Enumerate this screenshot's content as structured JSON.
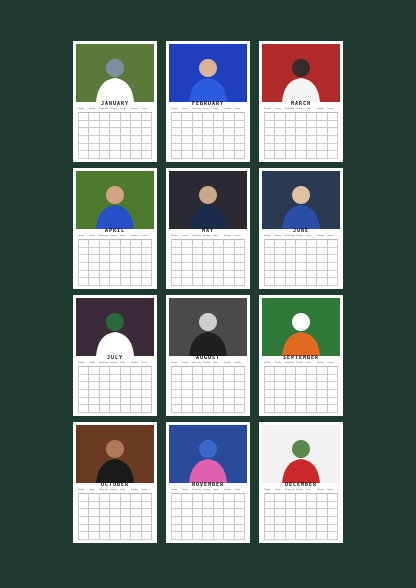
{
  "weekdays": [
    "Monday",
    "Tuesday",
    "Wednesday",
    "Thursday",
    "Friday",
    "Saturday",
    "Sunday"
  ],
  "months": [
    {
      "name": "JANUARY",
      "photo": "player-lifting-trophy-photo",
      "colors": [
        "#5a7a3a",
        "#ffffff",
        "#7b8fa0"
      ]
    },
    {
      "name": "FEBRUARY",
      "photo": "player-blue-kit-photo",
      "colors": [
        "#1f3fbf",
        "#2d5be0",
        "#d9b49a"
      ]
    },
    {
      "name": "MARCH",
      "photo": "player-white-kit-photo",
      "colors": [
        "#b02a2a",
        "#f4f4f4",
        "#3a2a2a"
      ]
    },
    {
      "name": "APRIL",
      "photo": "player-blue-shirt-portrait-photo",
      "colors": [
        "#4e7a2f",
        "#2550c8",
        "#d2a283"
      ]
    },
    {
      "name": "MAY",
      "photo": "players-dark-kit-photo",
      "colors": [
        "#2a2a32",
        "#1a2a4a",
        "#c8a888"
      ]
    },
    {
      "name": "JUNE",
      "photo": "player-number-22-photo",
      "colors": [
        "#2a3a52",
        "#2a4ea8",
        "#e0c0a0"
      ]
    },
    {
      "name": "JULY",
      "photo": "player-celebrating-photo",
      "colors": [
        "#3a2a3a",
        "#ffffff",
        "#2a6a3a"
      ]
    },
    {
      "name": "AUGUST",
      "photo": "dressing-room-shirt-photo",
      "colors": [
        "#4a4a4a",
        "#202020",
        "#cfcfcf"
      ]
    },
    {
      "name": "SEPTEMBER",
      "photo": "player-running-photo",
      "colors": [
        "#2f7a3a",
        "#e06a20",
        "#ffffff"
      ]
    },
    {
      "name": "OCTOBER",
      "photo": "player-back-view-photo",
      "colors": [
        "#6a3a22",
        "#1a1a1a",
        "#b07a5a"
      ]
    },
    {
      "name": "NOVEMBER",
      "photo": "goalkeeper-pink-kit-photo",
      "colors": [
        "#2a4a9a",
        "#e060b0",
        "#3a6ac8"
      ]
    },
    {
      "name": "DECEMBER",
      "photo": "player-red-top-photo",
      "colors": [
        "#f2f2f2",
        "#c82a2a",
        "#5a8a4a"
      ]
    }
  ]
}
